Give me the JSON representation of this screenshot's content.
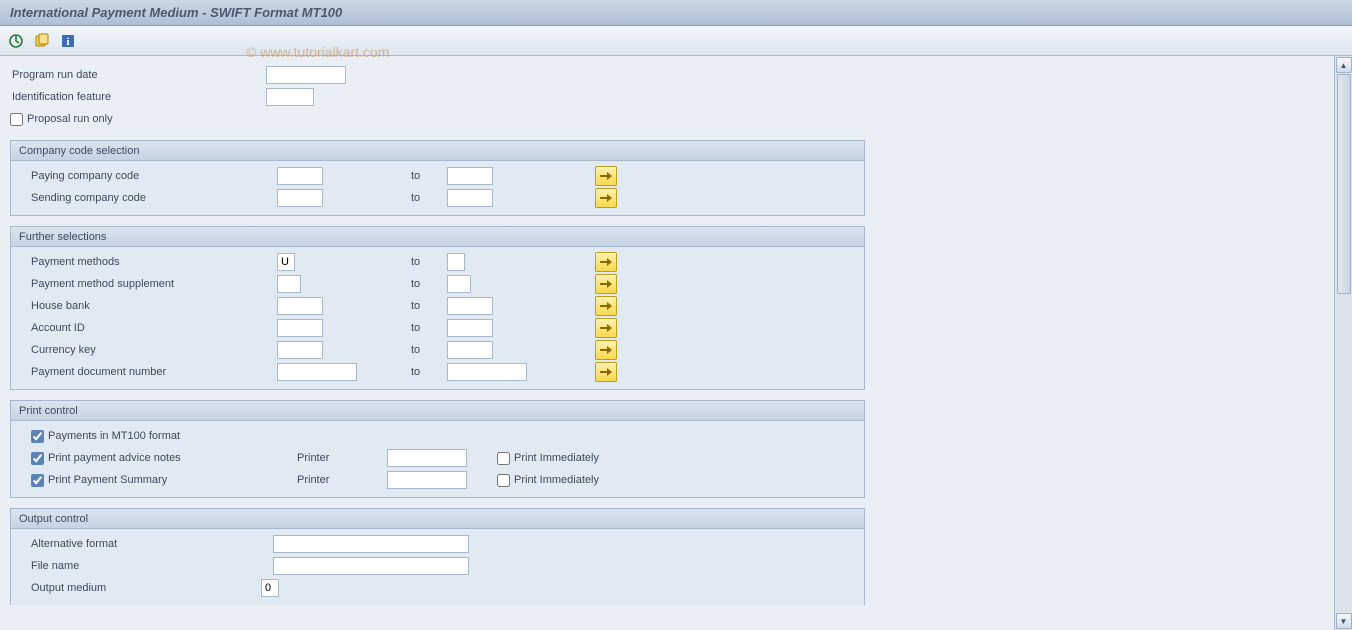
{
  "title": "International Payment Medium - SWIFT Format MT100",
  "watermark": "© www.tutorialkart.com",
  "topFields": {
    "program_run_date_label": "Program run date",
    "program_run_date_value": "",
    "identification_label": "Identification feature",
    "identification_value": "",
    "proposal_label": "Proposal run only",
    "proposal_checked": false
  },
  "group_company": {
    "title": "Company code selection",
    "rows": [
      {
        "label": "Paying company code",
        "from": "",
        "to": ""
      },
      {
        "label": "Sending company code",
        "from": "",
        "to": ""
      }
    ],
    "to_label": "to"
  },
  "group_further": {
    "title": "Further selections",
    "rows": [
      {
        "label": "Payment methods",
        "from": "U",
        "to": "",
        "fw": 18,
        "tw": 18
      },
      {
        "label": "Payment method supplement",
        "from": "",
        "to": "",
        "fw": 24,
        "tw": 24
      },
      {
        "label": "House bank",
        "from": "",
        "to": "",
        "fw": 46,
        "tw": 46
      },
      {
        "label": "Account ID",
        "from": "",
        "to": "",
        "fw": 46,
        "tw": 46
      },
      {
        "label": "Currency key",
        "from": "",
        "to": "",
        "fw": 46,
        "tw": 46
      },
      {
        "label": "Payment document number",
        "from": "",
        "to": "",
        "fw": 80,
        "tw": 80
      }
    ],
    "to_label": "to"
  },
  "group_print": {
    "title": "Print control",
    "mt100_label": "Payments in MT100 format",
    "mt100_checked": true,
    "advice_label": "Print payment advice notes",
    "advice_checked": true,
    "summary_label": "Print Payment Summary",
    "summary_checked": true,
    "printer_label": "Printer",
    "printer1_value": "",
    "printer2_value": "",
    "immediate_label": "Print Immediately",
    "immediate1_checked": false,
    "immediate2_checked": false
  },
  "group_output": {
    "title": "Output control",
    "alt_format_label": "Alternative format",
    "alt_format_value": "",
    "filename_label": "File name",
    "filename_value": "",
    "medium_label": "Output medium",
    "medium_value": "0"
  }
}
